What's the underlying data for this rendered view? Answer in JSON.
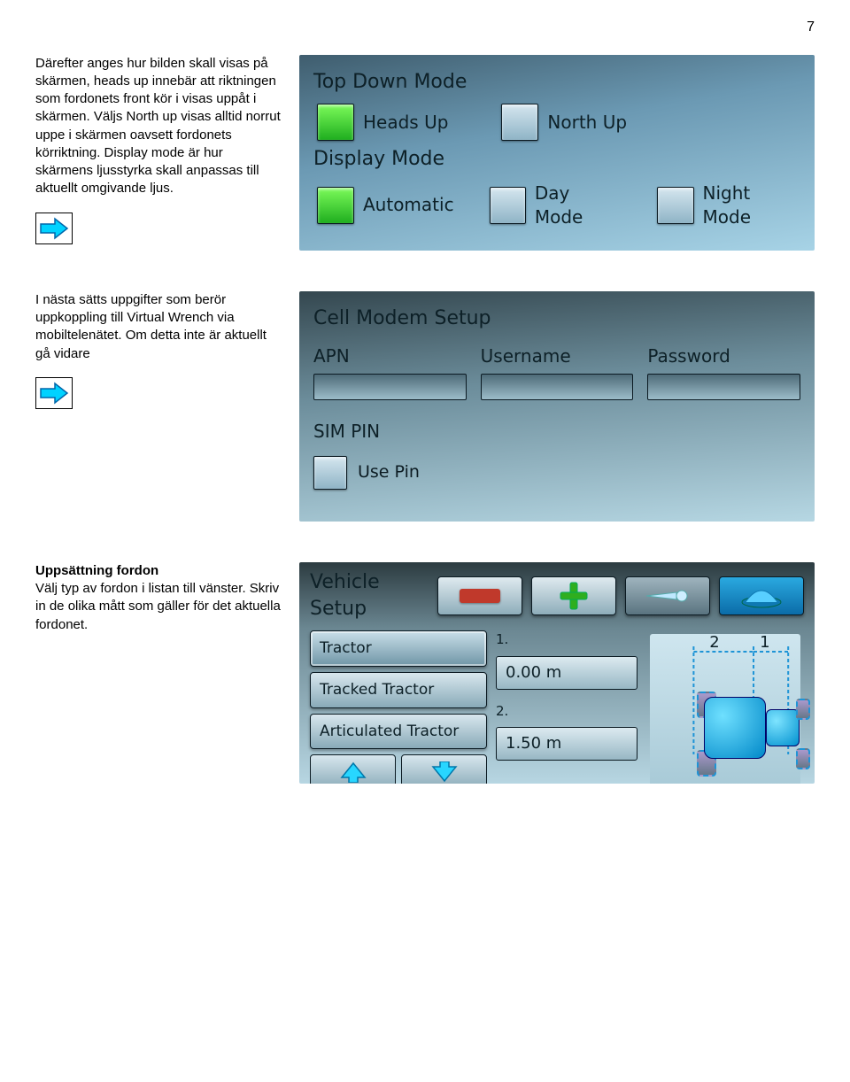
{
  "page_number": "7",
  "section1": {
    "paragraph": "Därefter anges hur bilden skall visas på skärmen, heads up innebär att riktningen som fordonets front kör i visas uppåt i skärmen. Väljs North up visas alltid norrut uppe i skärmen oavsett fordonets körriktning. Display mode är hur skärmens ljusstyrka skall anpassas till aktuellt omgivande ljus.",
    "shot": {
      "heading1": "Top Down Mode",
      "opt_headsup": "Heads Up",
      "opt_northup": "North Up",
      "heading2": "Display Mode",
      "opt_auto": "Automatic",
      "opt_day": "Day Mode",
      "opt_night": "Night Mode"
    }
  },
  "section2": {
    "paragraph": "I nästa sätts uppgifter som berör uppkoppling till Virtual Wrench via mobiltelenätet. Om detta inte är aktuellt gå vidare",
    "shot": {
      "heading": "Cell Modem Setup",
      "lbl_apn": "APN",
      "lbl_user": "Username",
      "lbl_pass": "Password",
      "heading2": "SIM PIN",
      "lbl_usepin": "Use Pin"
    }
  },
  "section3": {
    "heading": "Uppsättning fordon",
    "paragraph": "Välj typ av fordon i listan till vänster. Skriv in de olika mått som gäller för det aktuella fordonet.",
    "shot": {
      "title": "Vehicle Setup",
      "list": {
        "tractor": "Tractor",
        "tracked": "Tracked Tractor",
        "articulated": "Articulated Tractor"
      },
      "dim1_label": "1.",
      "dim1_value": "0.00 m",
      "dim2_label": "2.",
      "dim2_value": "1.50 m",
      "diag_n2": "2",
      "diag_n1": "1"
    }
  }
}
